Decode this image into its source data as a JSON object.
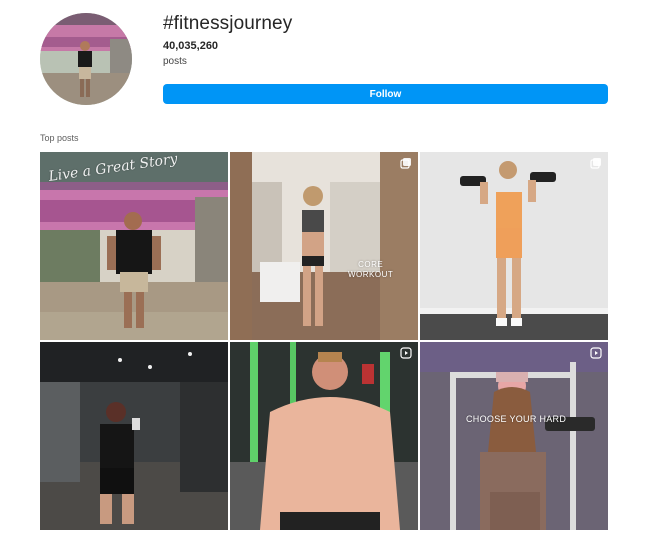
{
  "header": {
    "hashtag": "#fitnessjourney",
    "post_count": "40,035,260",
    "post_unit": "posts",
    "follow_label": "Follow",
    "follow_color": "#0095f6"
  },
  "top_posts": {
    "label": "Top posts",
    "posts": [
      {
        "overlay": "",
        "badge": "",
        "sign": "Live a Great Story"
      },
      {
        "overlay_line1": "CORE",
        "overlay_line2": "WORKOUT",
        "badge": "multiple-icon"
      },
      {
        "overlay": "",
        "badge": "multiple-icon"
      },
      {
        "overlay": "",
        "badge": ""
      },
      {
        "overlay": "",
        "badge": "reel-icon"
      },
      {
        "overlay": "CHOOSE YOUR HARD",
        "badge": "reel-icon"
      }
    ]
  }
}
